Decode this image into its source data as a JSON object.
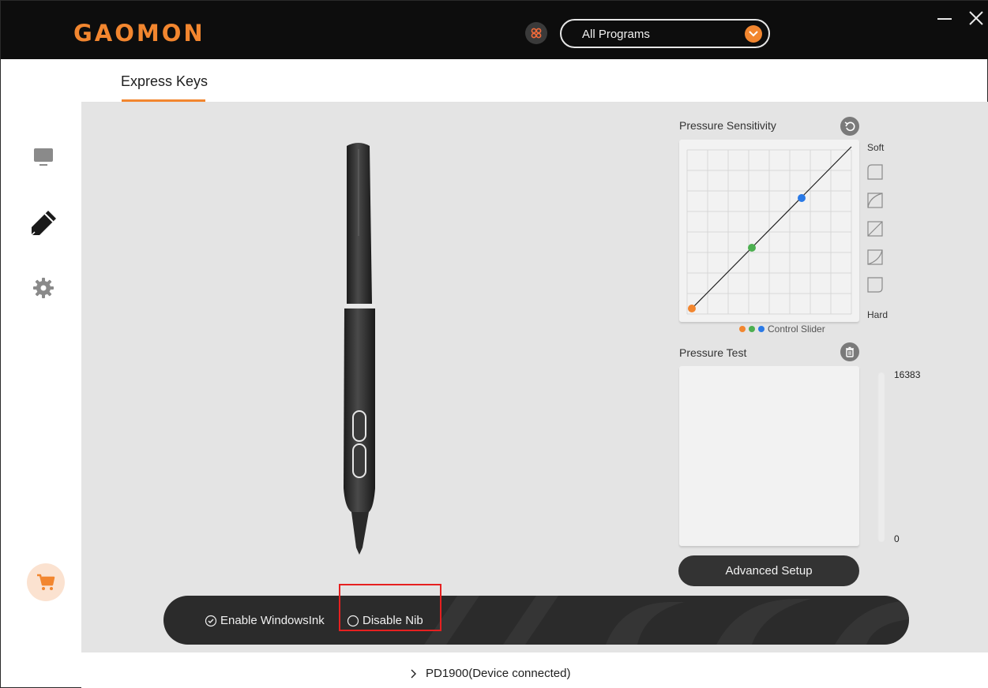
{
  "header": {
    "logo_text": "GAOMON",
    "program_select_value": "All Programs",
    "brand_color": "#f2862f",
    "icons": [
      "apps-icon",
      "chevron-down-icon",
      "minimize-icon",
      "close-icon"
    ]
  },
  "tabs": [
    {
      "label": "Express Keys",
      "active": true
    }
  ],
  "sidebar": {
    "items": [
      {
        "name": "display-icon",
        "active": false
      },
      {
        "name": "pen-icon",
        "active": true
      },
      {
        "name": "gear-icon",
        "active": false
      }
    ],
    "cart_icon": "cart-icon"
  },
  "pressure_sensitivity": {
    "title": "Pressure Sensitivity",
    "soft_label": "Soft",
    "hard_label": "Hard",
    "control_slider_label": "Control Slider",
    "slider_colors": [
      "#f2862f",
      "#4caf50",
      "#2979e6"
    ]
  },
  "pressure_test": {
    "title": "Pressure Test",
    "max_value": "16383",
    "min_value": "0",
    "level": 0
  },
  "advanced_button": "Advanced Setup",
  "options": {
    "enable_windows_ink": {
      "label": "Enable WindowsInk",
      "checked": true
    },
    "disable_nib": {
      "label": "Disable Nib",
      "checked": false
    }
  },
  "status": {
    "device_text": "PD1900(Device connected)"
  }
}
